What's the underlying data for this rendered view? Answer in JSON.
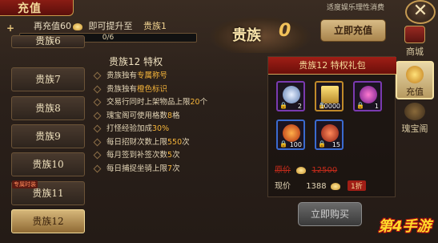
{
  "window": {
    "title": "充值",
    "notice": "适度娱乐理性消费",
    "close_glyph": "✕"
  },
  "progress": {
    "recharge_label": "再充值60",
    "promote_label": "即可提升至",
    "next_tier": "贵族1",
    "text": "0/6",
    "fraction": 0.0
  },
  "emblem": {
    "label": "贵族",
    "level": "0"
  },
  "charge_button": "立即充值",
  "side_tabs": {
    "shop": "商城",
    "charge": "充值",
    "treasure": "瑰宝阁"
  },
  "list": {
    "items": [
      "贵族7",
      "贵族8",
      "贵族9",
      "贵族10",
      "贵族11",
      "贵族12"
    ],
    "partial_top": "贵族6",
    "tag": "专属时装",
    "active_index": 5
  },
  "privileges": {
    "title": "贵族12 特权",
    "rows": [
      {
        "pre": "贵族独有",
        "hl": "专属称号",
        "post": ""
      },
      {
        "pre": "贵族独有",
        "hl": "橙色标识",
        "post": ""
      },
      {
        "pre": "交易行同时上架物品上限",
        "hl": "20",
        "post": "个"
      },
      {
        "pre": "瑰宝阁可使用格数",
        "hl": "8",
        "post": "格"
      },
      {
        "pre": "打怪经验加成",
        "hl": "30%",
        "post": ""
      },
      {
        "pre": "每日招财次数上限",
        "hl": "550",
        "post": "次"
      },
      {
        "pre": "每月签到补签次数",
        "hl": "5",
        "post": "次"
      },
      {
        "pre": "每日捕捉坐骑上限",
        "hl": "7",
        "post": "次"
      }
    ]
  },
  "gift": {
    "header": "贵族12 特权礼包",
    "items": [
      {
        "name": "ring",
        "qty": "2"
      },
      {
        "name": "gold-ticket",
        "qty": "10000"
      },
      {
        "name": "winged-chest",
        "qty": "1"
      },
      {
        "name": "fire-orb",
        "qty": "100"
      },
      {
        "name": "red-orb",
        "qty": "15"
      }
    ],
    "old_price_label": "原价",
    "old_price": "12500",
    "now_label": "现价",
    "now_price": "1388",
    "discount": "1折",
    "buy_label": "立即购买"
  },
  "watermark": "第4手游"
}
